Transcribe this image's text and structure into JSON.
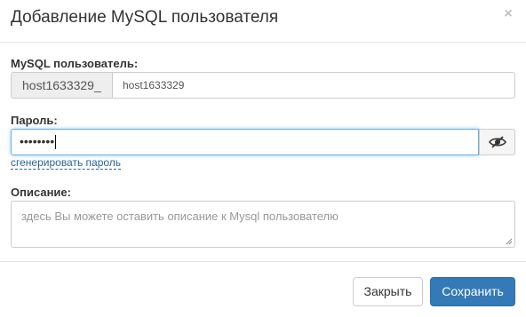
{
  "header": {
    "title": "Добавление MySQL пользователя",
    "close_glyph": "×"
  },
  "user_field": {
    "label": "MySQL пользователь:",
    "prefix": "host1633329_",
    "value": "host1633329"
  },
  "password_field": {
    "label": "Пароль:",
    "masked_value": "••••••••",
    "toggle_icon": "eye-slash-icon",
    "generate_link": "сгенерировать пароль"
  },
  "description_field": {
    "label": "Описание:",
    "placeholder": "здесь Вы можете оставить описание к Mysql пользователю"
  },
  "footer": {
    "close_label": "Закрыть",
    "save_label": "Сохранить"
  },
  "colors": {
    "primary": "#337ab7",
    "focus_border": "#66afe9",
    "link": "#2a6496"
  }
}
